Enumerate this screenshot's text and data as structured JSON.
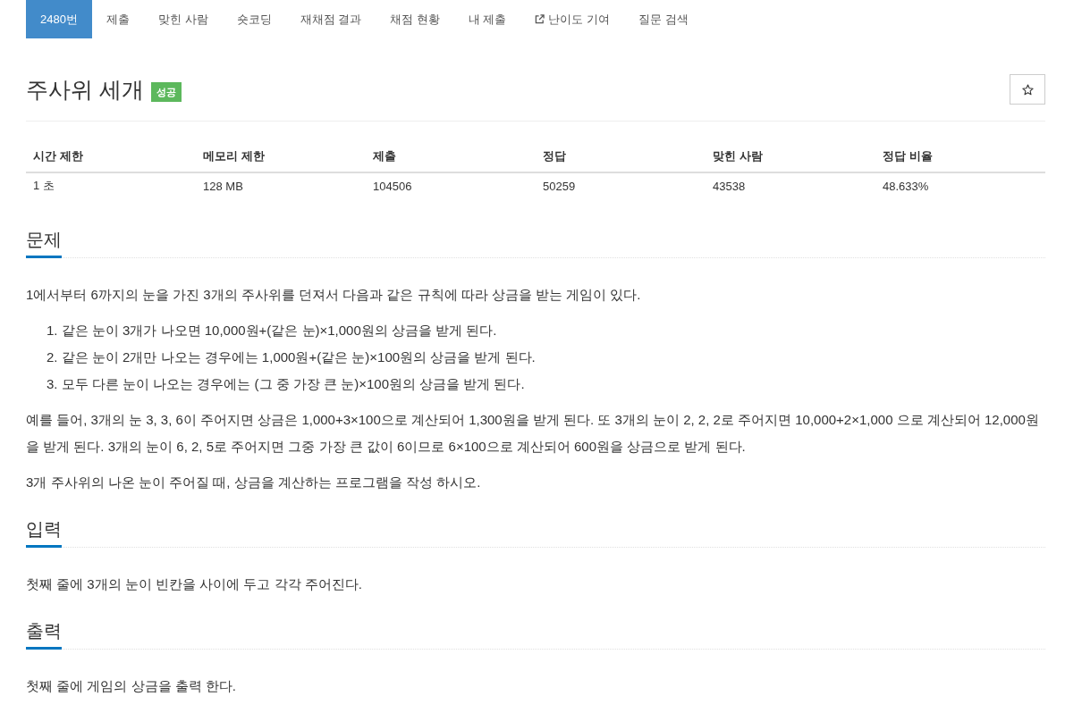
{
  "tabs": [
    {
      "label": "2480번",
      "selected": true,
      "kind": "plain"
    },
    {
      "label": "제출",
      "selected": false,
      "kind": "plain"
    },
    {
      "label": "맞힌 사람",
      "selected": false,
      "kind": "plain"
    },
    {
      "label": "숏코딩",
      "selected": false,
      "kind": "plain"
    },
    {
      "label": "재채점 결과",
      "selected": false,
      "kind": "plain"
    },
    {
      "label": "채점 현황",
      "selected": false,
      "kind": "plain"
    },
    {
      "label": "내 제출",
      "selected": false,
      "kind": "plain"
    },
    {
      "label": "난이도 기여",
      "selected": false,
      "kind": "external"
    },
    {
      "label": "질문 검색",
      "selected": false,
      "kind": "plain"
    }
  ],
  "problem": {
    "title": "주사위 세개",
    "status_badge": "성공",
    "starred": false
  },
  "info_table": {
    "columns": [
      "시간 제한",
      "메모리 제한",
      "제출",
      "정답",
      "맞힌 사람",
      "정답 비율"
    ],
    "rows": [
      [
        "1 초",
        "128 MB",
        "104506",
        "50259",
        "43538",
        "48.633%"
      ]
    ]
  },
  "sections": [
    {
      "heading": "문제",
      "content": [
        {
          "kind": "paragraph",
          "text": "1에서부터 6까지의 눈을 가진 3개의 주사위를 던져서 다음과 같은 규칙에 따라 상금을 받는 게임이 있다."
        },
        {
          "kind": "ordered_list",
          "items": [
            {
              "number": "1.",
              "text": "같은 눈이 3개가 나오면 10,000원+(같은 눈)×1,000원의 상금을 받게 된다."
            },
            {
              "number": "2.",
              "text": "같은 눈이 2개만 나오는 경우에는 1,000원+(같은 눈)×100원의 상금을 받게 된다."
            },
            {
              "number": "3.",
              "text": "모두 다른 눈이 나오는 경우에는 (그 중 가장 큰 눈)×100원의 상금을 받게 된다."
            }
          ]
        },
        {
          "kind": "paragraph",
          "text": "예를 들어, 3개의 눈 3, 3, 6이 주어지면 상금은 1,000+3×100으로 계산되어 1,300원을 받게 된다. 또 3개의 눈이 2, 2, 2로 주어지면 10,000+2×1,000 으로 계산되어 12,000원을 받게 된다. 3개의 눈이 6, 2, 5로 주어지면 그중 가장 큰 값이 6이므로 6×100으로 계산되어 600원을 상금으로 받게 된다."
        },
        {
          "kind": "paragraph",
          "text": "3개 주사위의 나온 눈이 주어질 때, 상금을 계산하는 프로그램을 작성 하시오."
        }
      ]
    },
    {
      "heading": "입력",
      "content": [
        {
          "kind": "paragraph",
          "text": "첫째 줄에 3개의 눈이 빈칸을 사이에 두고 각각 주어진다."
        }
      ]
    },
    {
      "heading": "출력",
      "content": [
        {
          "kind": "paragraph",
          "text": "첫째 줄에 게임의 상금을 출력 한다."
        }
      ]
    }
  ]
}
